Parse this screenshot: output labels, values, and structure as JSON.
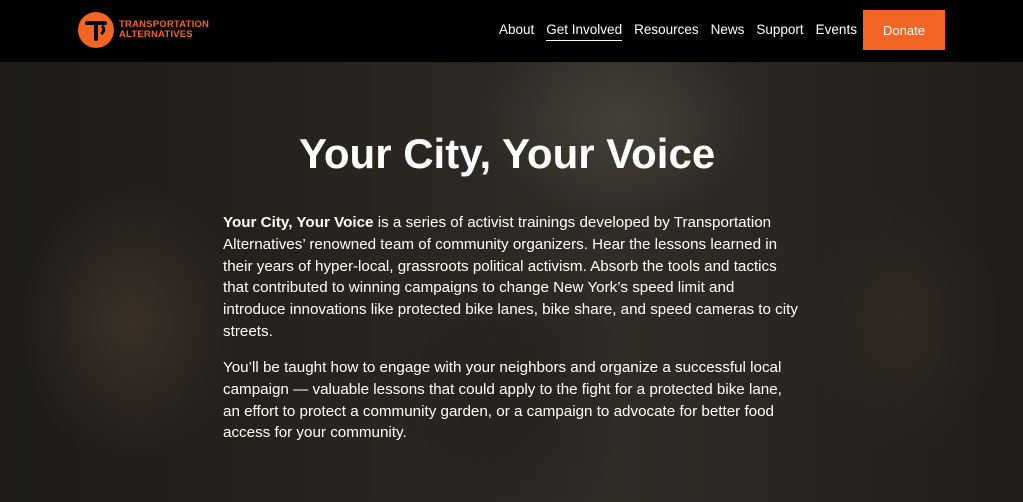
{
  "header": {
    "logo_line1": "TRANSPORTATION",
    "logo_line2": "ALTERNATIVES",
    "nav": [
      "About",
      "Get Involved",
      "Resources",
      "News",
      "Support",
      "Events"
    ],
    "active_nav": "Get Involved",
    "donate_label": "Donate",
    "accent_color": "#f26522"
  },
  "hero": {
    "title": "Your City, Your Voice",
    "p1_bold": "Your City, Your Voice",
    "p1_rest": " is a series of activist trainings developed by Transportation Alternatives’ renowned team of community organizers. Hear the lessons learned in their years of hyper-local, grassroots political activism. Absorb the tools and tactics that contributed to winning campaigns to change New York’s speed limit and introduce innovations like protected bike lanes, bike share, and speed cameras to city streets.",
    "p2": "You’ll be taught how to engage with your neighbors and organize a successful local campaign — valuable lessons that could apply to the fight for a protected bike lane, an effort to protect a community garden, or a campaign to advocate for better food access for your community."
  }
}
